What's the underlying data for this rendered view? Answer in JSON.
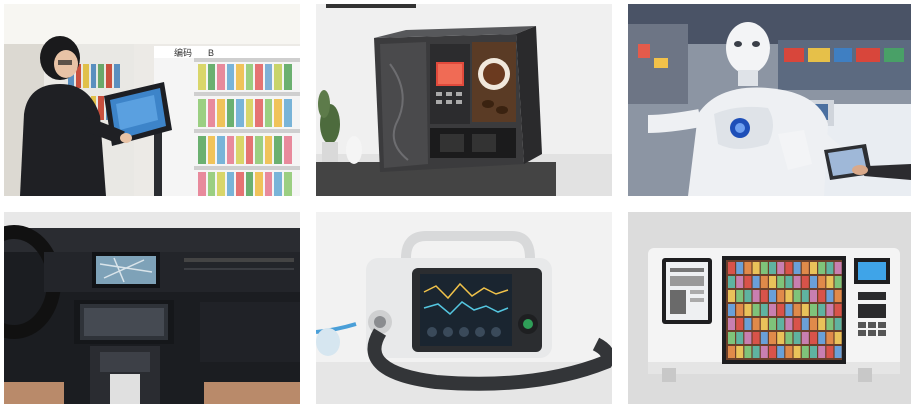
{
  "gallery": {
    "images": [
      {
        "subject": "person-using-touchscreen-kiosk-in-library",
        "shelf_sign_left": "编码",
        "shelf_sign_right": "B"
      },
      {
        "subject": "coffee-vending-machine-with-touchscreen"
      },
      {
        "subject": "humanoid-service-robot-with-tablet"
      },
      {
        "subject": "car-dashboard-with-navigation-screen"
      },
      {
        "subject": "portable-medical-ventilator-with-display"
      },
      {
        "subject": "self-service-book-kiosk-with-screens"
      }
    ]
  },
  "colors": {
    "background": "#ffffff",
    "library_shelf": "#f3f3f3",
    "coffee_body": "#3b3b3d",
    "robot_white": "#eef0f3",
    "car_interior": "#1b1d21",
    "ventilator_body": "#e8e9ea",
    "kiosk_white": "#f2f2f2"
  }
}
